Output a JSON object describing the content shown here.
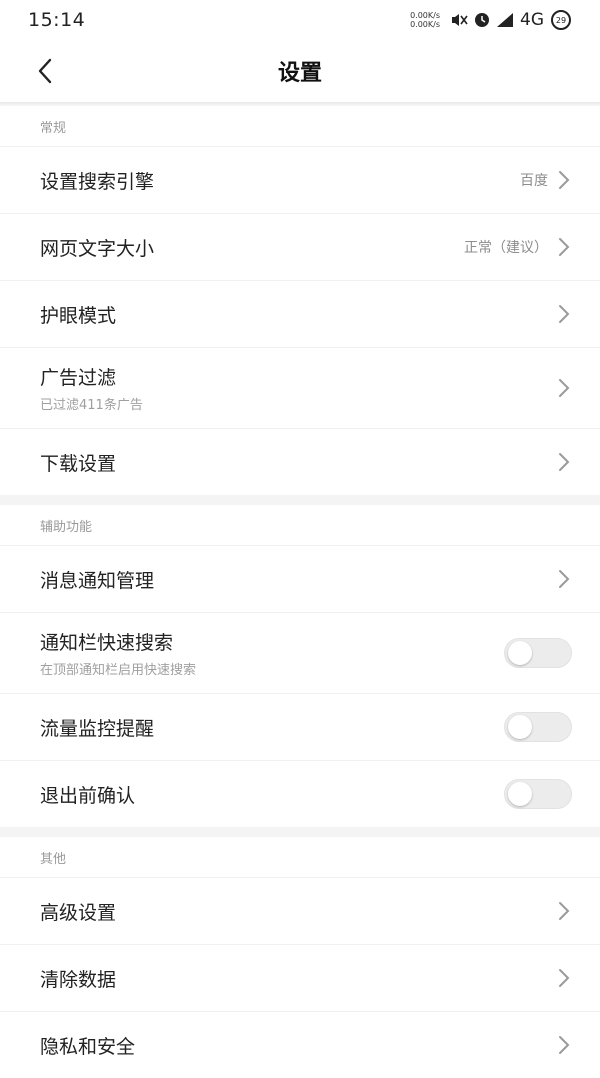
{
  "status_bar": {
    "time": "15:14",
    "net_speed_up": "0.00K/s",
    "net_speed_down": "0.00K/s",
    "network": "4G",
    "battery_level": "29",
    "icons": [
      "mute-icon",
      "alarm-icon",
      "signal-icon",
      "battery-icon"
    ]
  },
  "header": {
    "title": "设置",
    "back_icon": "chevron-left-icon"
  },
  "sections": {
    "general": {
      "title": "常规",
      "items": [
        {
          "title": "设置搜索引擎",
          "value": "百度"
        },
        {
          "title": "网页文字大小",
          "value": "正常（建议）"
        },
        {
          "title": "护眼模式"
        },
        {
          "title": "广告过滤",
          "subtitle": "已过滤411条广告"
        },
        {
          "title": "下载设置"
        }
      ]
    },
    "assist": {
      "title": "辅助功能",
      "items": [
        {
          "title": "消息通知管理"
        },
        {
          "title": "通知栏快速搜索",
          "subtitle": "在顶部通知栏启用快速搜索",
          "toggle": false
        },
        {
          "title": "流量监控提醒",
          "toggle": false
        },
        {
          "title": "退出前确认",
          "toggle": false
        }
      ]
    },
    "other": {
      "title": "其他",
      "items": [
        {
          "title": "高级设置"
        },
        {
          "title": "清除数据"
        },
        {
          "title": "隐私和安全"
        }
      ]
    }
  },
  "colors": {
    "background": "#ffffff",
    "section_gap": "#f4f4f4",
    "text_primary": "#222222",
    "text_secondary": "#9a9a9a",
    "toggle_off": "#ececec"
  }
}
